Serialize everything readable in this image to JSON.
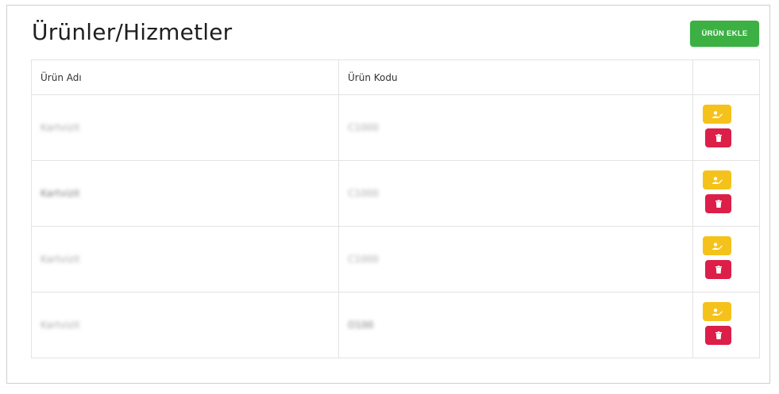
{
  "page": {
    "title": "Ürünler/Hizmetler",
    "add_button_label": "ÜRÜN EKLE"
  },
  "table": {
    "columns": [
      "Ürün Adı",
      "Ürün Kodu",
      ""
    ],
    "rows": [
      {
        "name": "Kartvizit",
        "code": "C1000"
      },
      {
        "name": "Kartvizit",
        "code": "C1000"
      },
      {
        "name": "Kartvizit",
        "code": "C1000"
      },
      {
        "name": "Kartvizit",
        "code": "O100"
      }
    ]
  },
  "colors": {
    "add_button": "#3cb043",
    "edit_button": "#f5c21b",
    "delete_button": "#dc1f48"
  },
  "icons": {
    "edit": "user-edit-icon",
    "delete": "trash-icon"
  }
}
